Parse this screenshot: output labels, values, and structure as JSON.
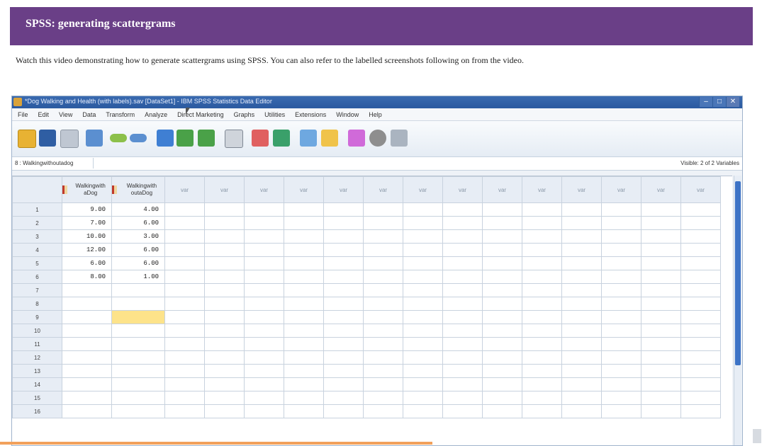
{
  "page": {
    "header_title": "SPSS: generating scattergrams",
    "intro_text": "Watch this video demonstrating how to generate scattergrams using SPSS. You can also refer to the labelled screenshots following on from the video."
  },
  "spss": {
    "window_title": "*Dog Walking and Health (with labels).sav [DataSet1] - IBM SPSS Statistics Data Editor",
    "win_minimize": "–",
    "win_maximize": "□",
    "win_close": "✕",
    "menu": [
      "File",
      "Edit",
      "View",
      "Data",
      "Transform",
      "Analyze",
      "Direct Marketing",
      "Graphs",
      "Utilities",
      "Extensions",
      "Window",
      "Help"
    ],
    "toolbar_icons": [
      "open-folder-icon",
      "save-icon",
      "print-icon",
      "recall-dialog-icon",
      "undo-icon",
      "redo-icon",
      "goto-case-icon",
      "goto-variable-icon",
      "variables-icon",
      "find-icon",
      "split-file-icon",
      "weight-cases-icon",
      "select-cases-icon",
      "value-labels-icon",
      "use-sets-icon",
      "scripts-icon",
      "spell-check-icon"
    ],
    "cell_reference": "8 : Walkingwithoutadog",
    "visible_label": "Visible: 2 of 2 Variables",
    "columns": [
      "Walkingwith aDog",
      "Walkingwith outaDog"
    ],
    "empty_col_label": "var",
    "rows": [
      {
        "n": "1",
        "a": "9.00",
        "b": "4.00"
      },
      {
        "n": "2",
        "a": "7.00",
        "b": "6.00"
      },
      {
        "n": "3",
        "a": "10.00",
        "b": "3.00"
      },
      {
        "n": "4",
        "a": "12.00",
        "b": "6.00"
      },
      {
        "n": "5",
        "a": "6.00",
        "b": "6.00"
      },
      {
        "n": "6",
        "a": "8.00",
        "b": "1.00"
      },
      {
        "n": "7",
        "a": "",
        "b": ""
      },
      {
        "n": "8",
        "a": "",
        "b": ""
      },
      {
        "n": "9",
        "a": "",
        "b": ""
      },
      {
        "n": "10",
        "a": "",
        "b": ""
      },
      {
        "n": "11",
        "a": "",
        "b": ""
      },
      {
        "n": "12",
        "a": "",
        "b": ""
      },
      {
        "n": "13",
        "a": "",
        "b": ""
      },
      {
        "n": "14",
        "a": "",
        "b": ""
      },
      {
        "n": "15",
        "a": "",
        "b": ""
      },
      {
        "n": "16",
        "a": "",
        "b": ""
      }
    ],
    "highlight_color": "#fde38a",
    "accent": "#6a3f87"
  }
}
